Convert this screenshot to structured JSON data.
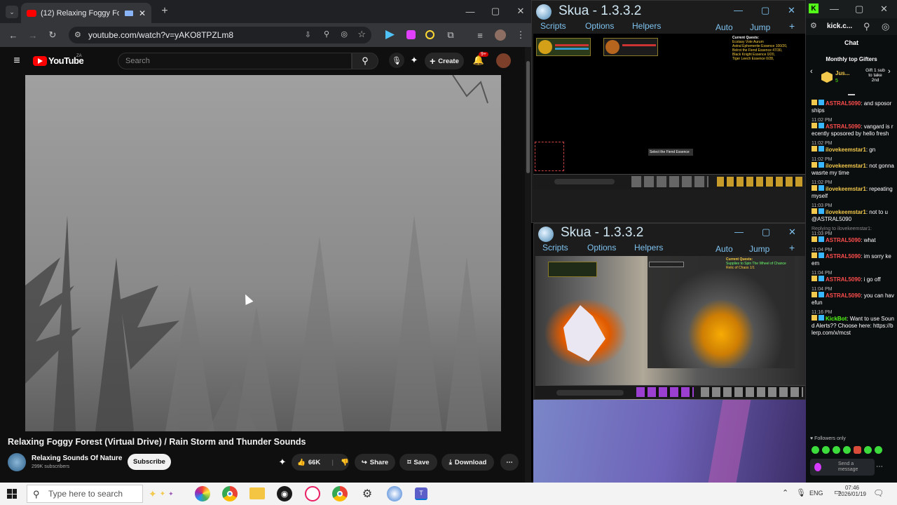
{
  "browser": {
    "tab_title": "(12) Relaxing Foggy Forest (",
    "url": "youtube.com/watch?v=yAKO8TPZLm8",
    "new_tab": "+"
  },
  "youtube": {
    "logo": "YouTube",
    "logo_sup": "ZA",
    "search_placeholder": "Search",
    "create_label": "Create",
    "notif_count": "9+",
    "video_title": "Relaxing Foggy Forest (Virtual Drive) / Rain Storm and Thunder Sounds",
    "channel_name": "Relaxing Sounds Of Nature",
    "subscribers": "299K subscribers",
    "subscribe_label": "Subscribe",
    "likes": "66K",
    "share_label": "Share",
    "save_label": "Save",
    "download_label": "Download"
  },
  "skua1": {
    "title": "Skua - 1.3.3.2",
    "menu": [
      "Scripts",
      "Options",
      "Helpers"
    ],
    "auto": "Auto",
    "jump": "Jump",
    "quest_title": "Current Quests:",
    "quest_lines": [
      "Ecstasy Vote Aurum",
      "Astral Ephemerite Essence 100/20,",
      "Belrot the Fiend Essence 47/30,",
      "Black Knight Essence 0/20,",
      "Tiger Leech Essence 0/28,"
    ],
    "target_label": "Select the Fiend Essence"
  },
  "skua2": {
    "title": "Skua - 1.3.3.2",
    "menu": [
      "Scripts",
      "Options",
      "Helpers"
    ],
    "auto": "Auto",
    "jump": "Jump",
    "quest_title": "Current Quests:",
    "quest_lines": [
      "Supplies to Spin The Wheel of Chance",
      "Relic of Chaos 1/1"
    ]
  },
  "kick": {
    "url": "kick.c...",
    "chat_title": "Chat",
    "gifters_title": "Monthly top Gifters",
    "gifter_name": "Jus...",
    "gifter_count": "5",
    "gift_text": "Gift 1 sub to take 2nd",
    "messages": [
      {
        "time": "",
        "user": "ASTRAL5090",
        "color": "#ff4d4d",
        "text": "and sposorships"
      },
      {
        "time": "11:02 PM",
        "user": "ASTRAL5090",
        "color": "#ff4d4d",
        "text": "vangard is recently sposored by hello fresh"
      },
      {
        "time": "11:02 PM",
        "user": "ilovekeemstar1",
        "color": "#f2c94c",
        "text": "gn"
      },
      {
        "time": "11:02 PM",
        "user": "ilovekeemstar1",
        "color": "#f2c94c",
        "text": "not gonna wasrte my time"
      },
      {
        "time": "11:02 PM",
        "user": "ilovekeemstar1",
        "color": "#f2c94c",
        "text": "repeating myself"
      },
      {
        "time": "11:03 PM",
        "user": "ilovekeemstar1",
        "color": "#f2c94c",
        "text": "not to u @ASTRAL5090"
      },
      {
        "time": "11:03 PM",
        "user": "ASTRAL5090",
        "color": "#ff4d4d",
        "text": "what",
        "reply": "Replying to ilovekeemstar1:"
      },
      {
        "time": "11:04 PM",
        "user": "ASTRAL5090",
        "color": "#ff4d4d",
        "text": "im sorry keem"
      },
      {
        "time": "11:04 PM",
        "user": "ASTRAL5090",
        "color": "#ff4d4d",
        "text": "i go off"
      },
      {
        "time": "11:04 PM",
        "user": "ASTRAL5090",
        "color": "#ff4d4d",
        "text": "you can hav efun"
      },
      {
        "time": "11:16 PM",
        "user": "KickBot",
        "color": "#53fc18",
        "text": "Want to use Sound Alerts?? Choose here: https://blerp.com/x/mcst"
      }
    ],
    "followers_only": "Followers only",
    "send_placeholder": "Send a message"
  },
  "taskbar": {
    "search_placeholder": "Type here to search",
    "lang": "ENG",
    "time": "07:46",
    "date": "2026/01/19"
  },
  "colors": {
    "youtube_red": "#ff0000",
    "kick_green": "#53fc18",
    "skua_blue": "#7fc3f0"
  }
}
